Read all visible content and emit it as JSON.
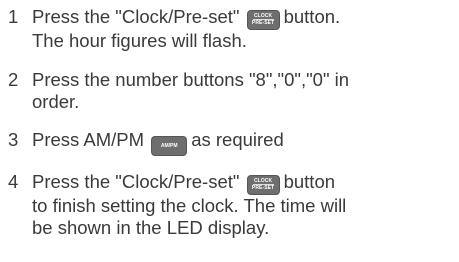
{
  "steps": [
    {
      "number": "1",
      "pre": "Press the \"Clock/Pre-set\"",
      "post": "button.",
      "line2": "The hour figures will flash."
    },
    {
      "number": "2",
      "line1": "Press the number buttons \"8\",\"0\",\"0\" in",
      "line2": "order."
    },
    {
      "number": "3",
      "pre": "Press AM/PM",
      "post": "as required"
    },
    {
      "number": "4",
      "pre": "Press the \"Clock/Pre-set\"",
      "post": "button",
      "line2": "to finish setting the clock. The time will",
      "line3": "be shown in the LED display."
    }
  ],
  "buttons": {
    "clock_top": "CLOCK",
    "clock_bottom": "PRE-SET",
    "ampm": "AM/PM"
  }
}
